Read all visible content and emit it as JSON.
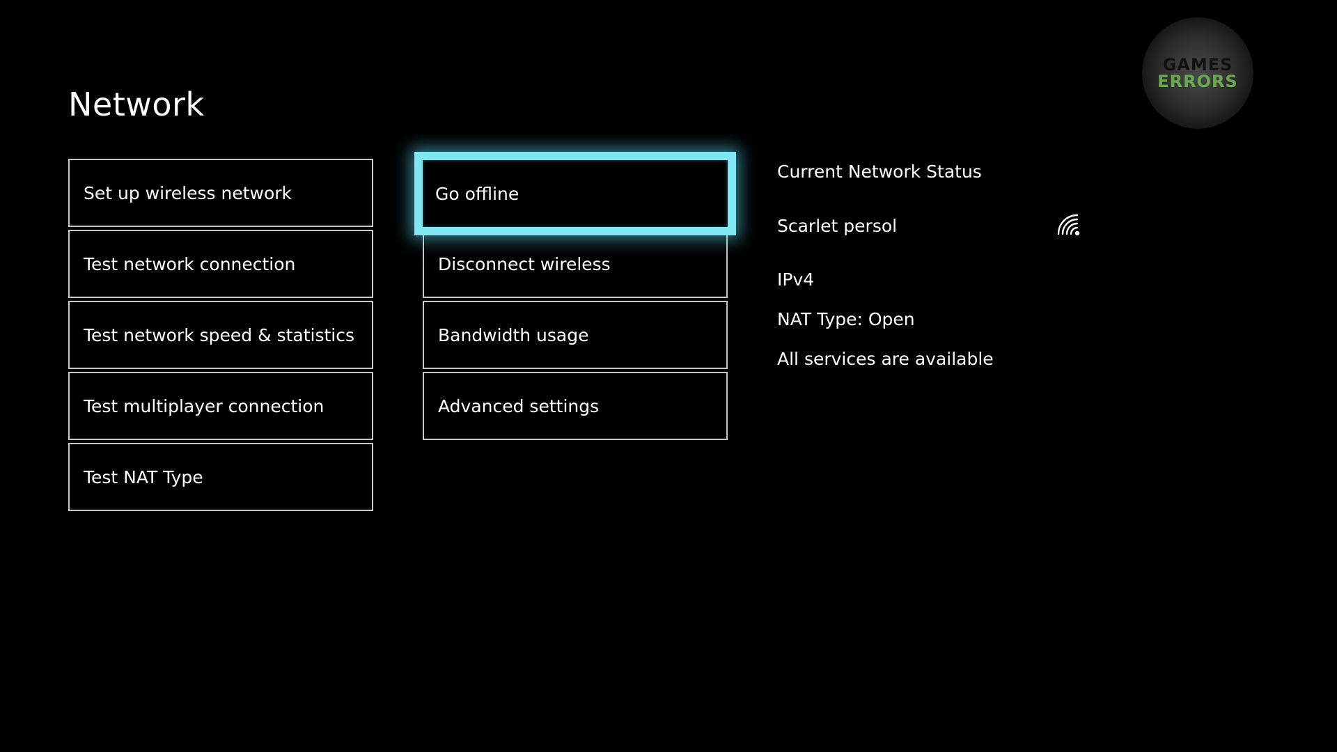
{
  "page": {
    "title": "Network"
  },
  "left_menu": {
    "items": [
      {
        "label": "Set up wireless network"
      },
      {
        "label": "Test network connection"
      },
      {
        "label": "Test network speed & statistics"
      },
      {
        "label": "Test multiplayer connection"
      },
      {
        "label": "Test NAT Type"
      }
    ]
  },
  "middle_menu": {
    "focused_item": "Go offline",
    "items": [
      {
        "label": "Go offline"
      },
      {
        "label": "Disconnect wireless"
      },
      {
        "label": "Bandwidth usage"
      },
      {
        "label": "Advanced settings"
      }
    ]
  },
  "status": {
    "heading": "Current Network Status",
    "network_name": "Scarlet persol",
    "network_icon": "wifi-signal-icon",
    "ip_version": "IPv4",
    "nat_type": "NAT Type: Open",
    "services": "All services are available"
  },
  "watermark": {
    "line1": "GAMES",
    "line2": "ERRORS"
  },
  "colors": {
    "background": "#000000",
    "focus_accent": "#7fe6f4",
    "tile_border": "#c8c8c8",
    "watermark_green": "#6aa84f"
  }
}
